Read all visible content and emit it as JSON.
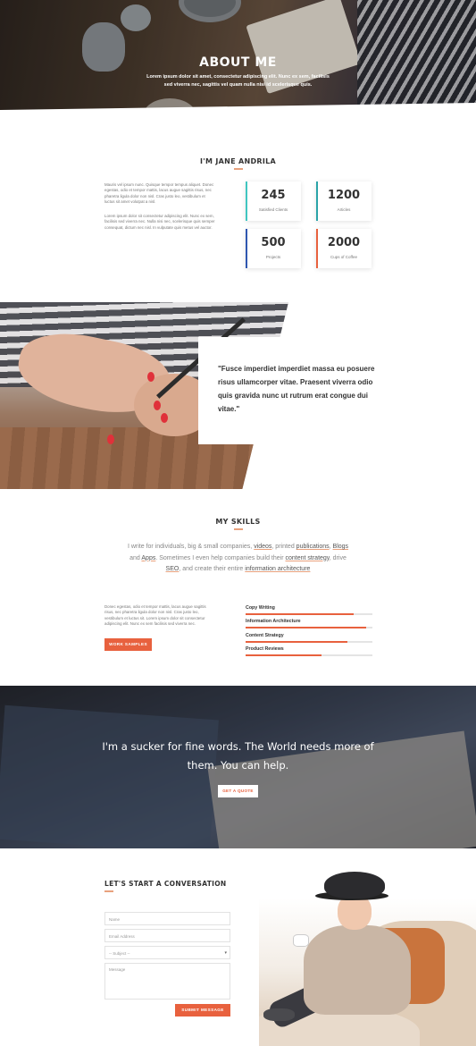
{
  "hero": {
    "title": "ABOUT ME",
    "text": "Lorem ipsum dolor sit amet, consectetur adipiscing elit. Nunc ex sem, facilisis sed viverra nec, sagittis vel quam nulla nisi id scelerisque quis."
  },
  "about": {
    "title": "I'M JANE ANDRILA",
    "paragraph1": "Mauris vel ipsum nunc. Quisque tempor tempus aliquet. Donec egestas, odio et tempor mattis, lacus augue sagittis risus, nec pharetra ligula dolor non nisl. Cras justo leo, vestibulum et luctus sit amet volutpat a nisl.",
    "paragraph2": "Lorem ipsum dolor sit consectetur adipiscing elit. Nunc ex sem, facilisis sed viverra nec. Nulla nisi nec, scelerisque quis semper consequat, dictum nec nisl. In vulputate quis metus vel auctor.",
    "stats": [
      {
        "number": "245",
        "label": "Satisfied Clients",
        "color": "#3fc6c0"
      },
      {
        "number": "1200",
        "label": "Articles",
        "color": "#2aa3a8"
      },
      {
        "number": "500",
        "label": "Projects",
        "color": "#2f56b0"
      },
      {
        "number": "2000",
        "label": "Cups of Coffee",
        "color": "#e8613e"
      }
    ]
  },
  "quote": {
    "text": "\"Fusce imperdiet imperdiet massa eu posuere risus ullamcorper vitae. Praesent viverra odio quis gravida nunc ut rutrum erat congue dui vitae.\""
  },
  "skills": {
    "title": "MY SKILLS",
    "intro": {
      "t1": "I write for individuals, big & small companies, ",
      "l1": "videos",
      "t2": ", printed ",
      "l2": "publications",
      "t3": ", ",
      "l3": "Blogs",
      "t4": " and ",
      "l4": "Apps",
      "t5": ". Sometimes I even help companies build their ",
      "l5": "content strategy",
      "t6": ", drive ",
      "l6": "SEO",
      "t7": ", and create their entire ",
      "l7": "information architecture"
    },
    "paragraph": "Donec egestas, odio et tempor mattis, lacus augue sagittis risus, nec pharetra ligula dolor non nisl. Cras justo leo, vestibulum et luctus sit. Lorem ipsum dolor sit consectetur adipiscing elit. Nunc ex sem facilisis sed viverra nec.",
    "button": "WORK SAMPLES",
    "bars": [
      {
        "label": "Copy Writing",
        "value": 0.85
      },
      {
        "label": "Information Architecture",
        "value": 0.95
      },
      {
        "label": "Content Strategy",
        "value": 0.8
      },
      {
        "label": "Product Reviews",
        "value": 0.6
      }
    ],
    "accent": "#e8613e"
  },
  "cta": {
    "text": "I'm a sucker for fine words. The World needs more of them. You can help.",
    "button": "GET A QUOTE"
  },
  "contact": {
    "title": "LET'S START A CONVERSATION",
    "name_placeholder": "Name",
    "email_placeholder": "Email Address",
    "subject_value": "-- Subject --",
    "message_placeholder": "Message",
    "submit": "SUBMIT MESSAGE"
  }
}
